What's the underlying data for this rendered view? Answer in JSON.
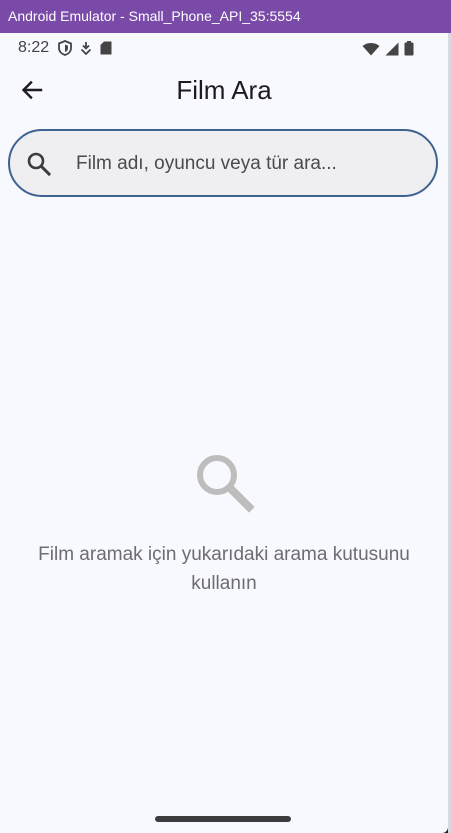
{
  "window": {
    "title": "Android Emulator - Small_Phone_API_35:5554"
  },
  "statusbar": {
    "time": "8:22",
    "left_icons": [
      "shield-icon",
      "download-icon",
      "sd-card-icon"
    ],
    "right_icons": [
      "wifi-icon",
      "signal-icon",
      "battery-icon"
    ]
  },
  "appbar": {
    "back_icon": "arrow-left-icon",
    "title": "Film Ara"
  },
  "search": {
    "icon": "search-icon",
    "value": "",
    "placeholder": "Film adı, oyuncu veya tür ara..."
  },
  "empty_state": {
    "icon": "search-icon",
    "message": "Film aramak için yukarıdaki arama kutusunu kullanın"
  },
  "colors": {
    "titlebar": "#7a4aa8",
    "background": "#f8f8ff",
    "search_border": "#3e6391",
    "search_fill": "#efeff1",
    "empty_text": "#6c6c72",
    "empty_icon": "#bdbdbd"
  }
}
